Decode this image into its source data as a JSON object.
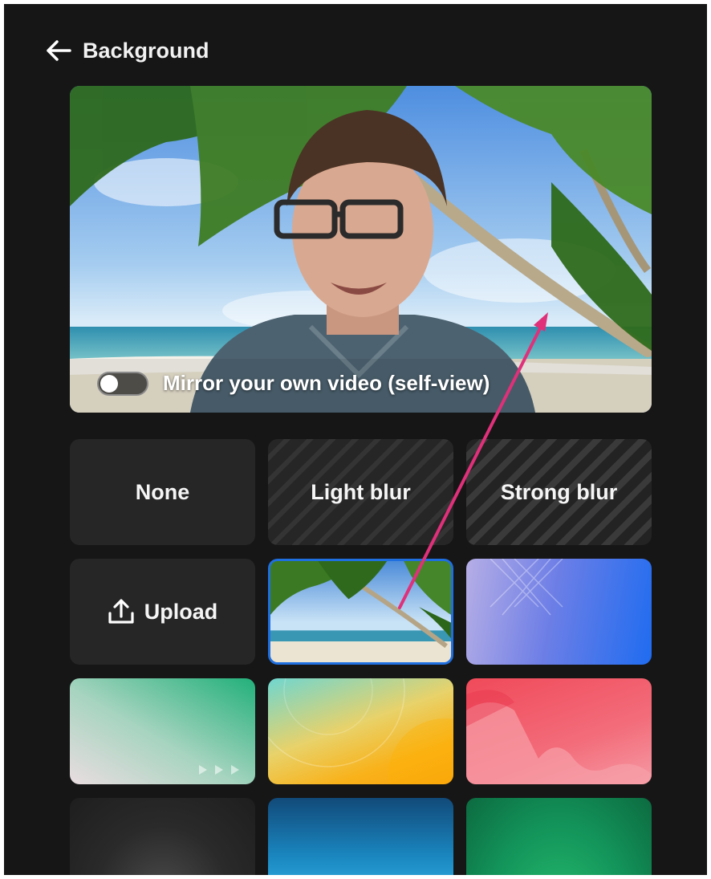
{
  "header": {
    "title": "Background",
    "back_icon": "arrow-left-icon"
  },
  "preview": {
    "mirror_label": "Mirror your own video (self-view)",
    "mirror_enabled": false
  },
  "options": [
    {
      "label": "None",
      "kind": "text"
    },
    {
      "label": "Light blur",
      "kind": "text"
    },
    {
      "label": "Strong blur",
      "kind": "text"
    },
    {
      "label": "Upload",
      "kind": "upload",
      "icon": "upload-icon"
    },
    {
      "kind": "image",
      "theme": "tropical-beach",
      "selected": true
    },
    {
      "kind": "image",
      "theme": "blue-purple-gradient"
    },
    {
      "kind": "image",
      "theme": "green-gradient"
    },
    {
      "kind": "image",
      "theme": "teal-yellow-gradient"
    },
    {
      "kind": "image",
      "theme": "pink-red-waves"
    },
    {
      "kind": "image",
      "theme": "dark-gray-gradient"
    },
    {
      "kind": "image",
      "theme": "blue-gradient"
    },
    {
      "kind": "image",
      "theme": "green-dark-gradient"
    }
  ],
  "colors": {
    "accent": "#1f6fe0",
    "annotation": "#e0307a",
    "panel": "#161616",
    "tile": "#262626"
  }
}
